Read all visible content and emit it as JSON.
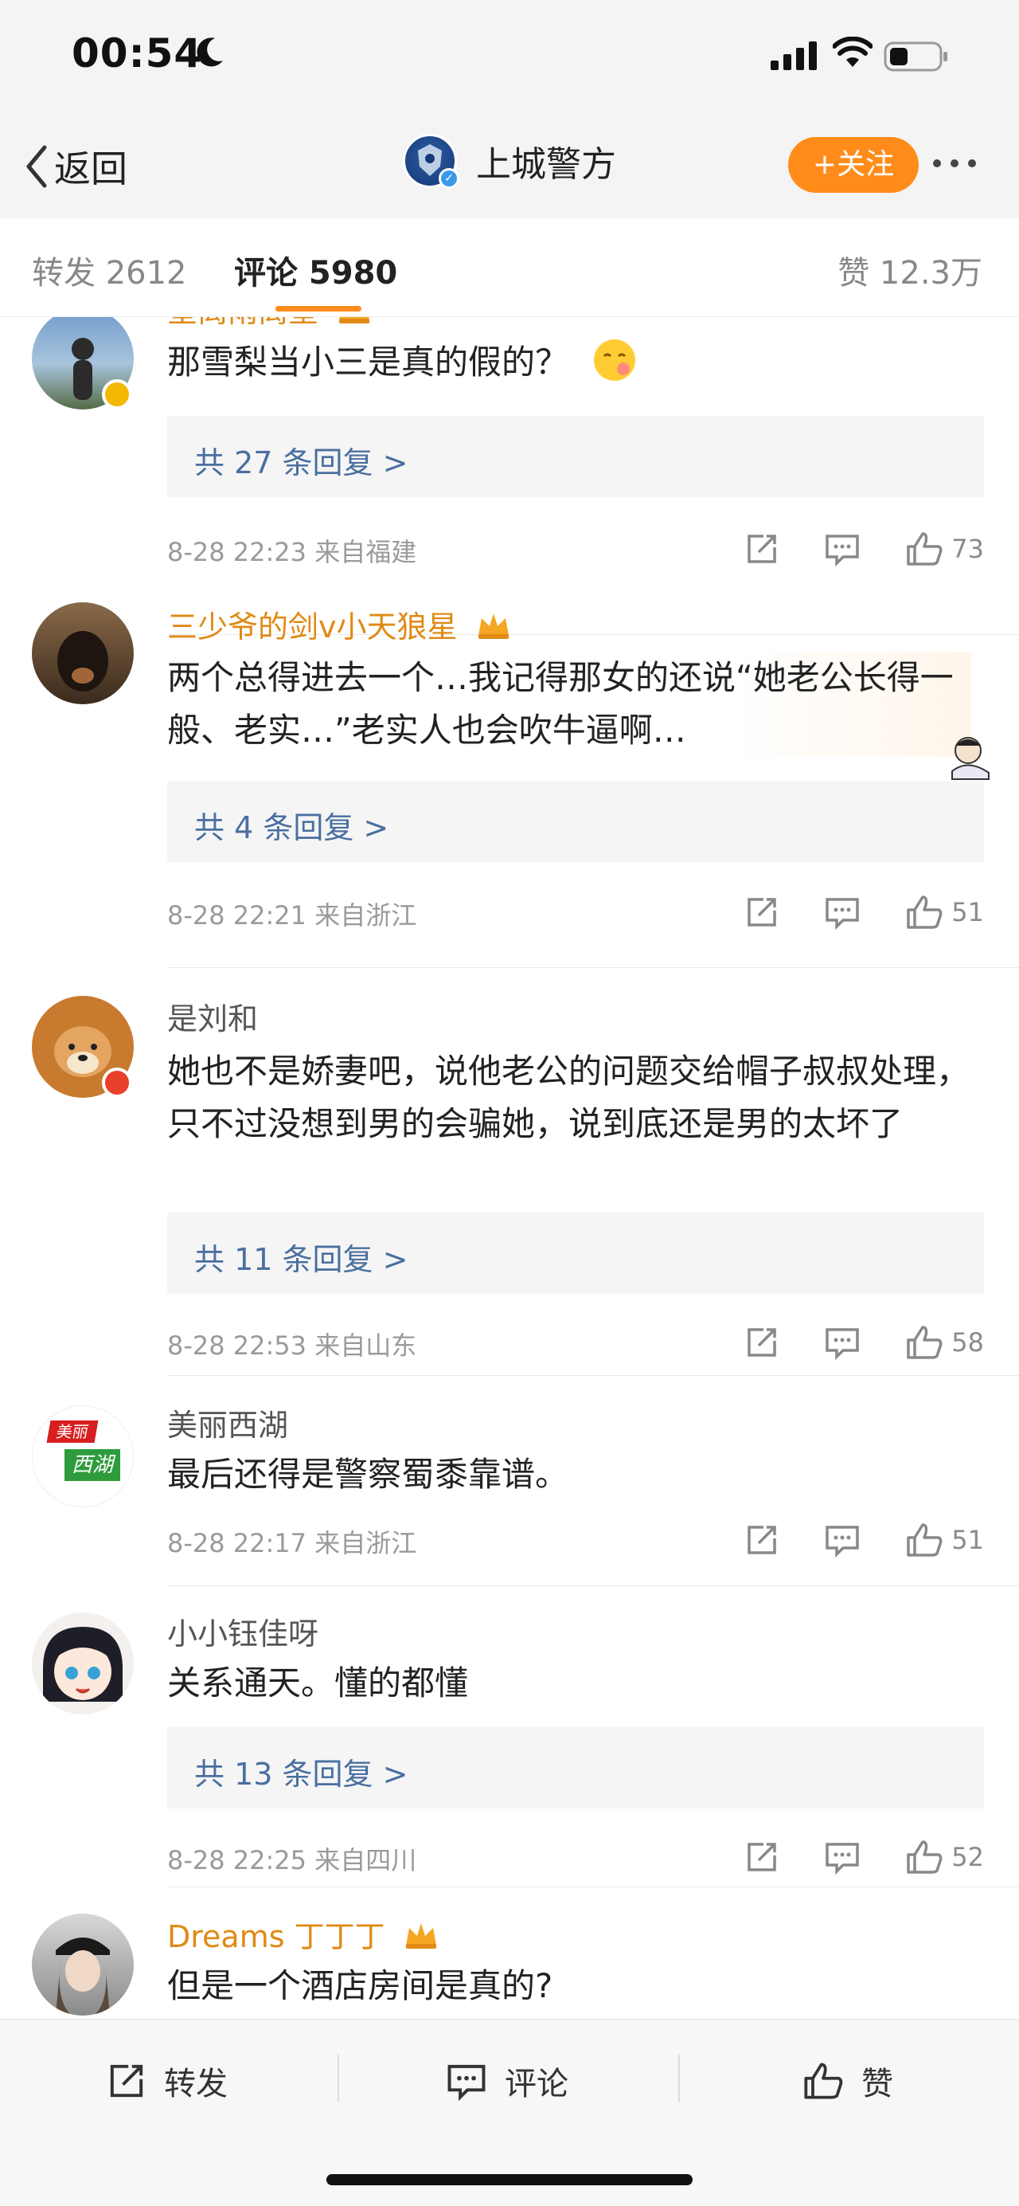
{
  "status_bar": {
    "time": "00:54"
  },
  "nav": {
    "back_label": "返回",
    "account_name": "上城警方",
    "follow_label": "+关注"
  },
  "tabs": {
    "repost": "转发 2612",
    "comments": "评论 5980",
    "likes": "赞 12.3万"
  },
  "colors": {
    "accent": "#ff8c1a",
    "vip_name": "#e08a14",
    "reply_link": "#4a6fa0"
  },
  "comments": [
    {
      "username": "星离雨离星",
      "text": "那雪梨当小三是真的假的？",
      "has_emoji": true,
      "replies": "共 27 条回复 >",
      "time": "8-28 22:23 来自福建",
      "likes": "73"
    },
    {
      "username": "三少爷的剑v小天狼星",
      "text": "两个总得进去一个…我记得那女的还说“她老公长得一般、老实…”老实人也会吹牛逼啊…",
      "replies": "共 4 条回复 >",
      "time": "8-28 22:21 来自浙江",
      "likes": "51"
    },
    {
      "username": "是刘和",
      "text": "她也不是娇妻吧，说他老公的问题交给帽子叔叔处理，只不过没想到男的会骗她，说到底还是男的太坏了",
      "replies": "共 11 条回复 >",
      "time": "8-28 22:53 来自山东",
      "likes": "58"
    },
    {
      "username": "美丽西湖",
      "avatar_text_top": "美丽",
      "avatar_text_bottom": "西湖",
      "text": "最后还得是警察蜀黍靠谱。",
      "time": "8-28 22:17 来自浙江",
      "likes": "51"
    },
    {
      "username": "小小钰佳呀",
      "text": "关系通天。懂的都懂",
      "replies": "共 13 条回复 >",
      "time": "8-28 22:25 来自四川",
      "likes": "52"
    },
    {
      "username": "Dreams 丁丁丁",
      "text": "但是一个酒店房间是真的?"
    }
  ],
  "bottom_bar": {
    "repost": "转发",
    "comment": "评论",
    "like": "赞"
  }
}
